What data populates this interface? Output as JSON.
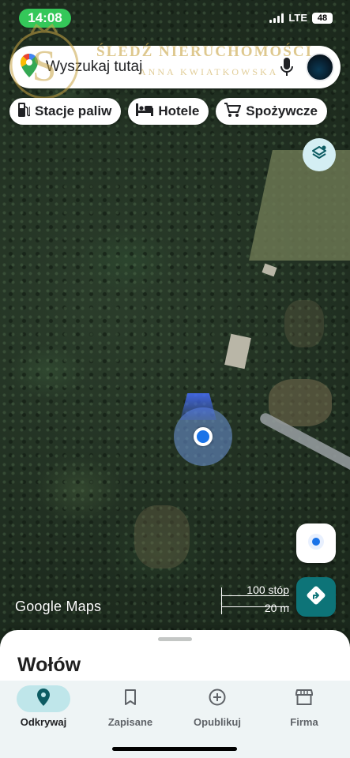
{
  "status_bar": {
    "time": "14:08",
    "network": "LTE",
    "battery": "48"
  },
  "search": {
    "placeholder": "Wyszukaj tutaj"
  },
  "chips": [
    {
      "label": "Stacje paliw",
      "icon": "gas-station-icon"
    },
    {
      "label": "Hotele",
      "icon": "bed-icon"
    },
    {
      "label": "Spożywcze",
      "icon": "cart-icon"
    }
  ],
  "watermark": {
    "title": "ŚLEDŹ NIERUCHOMOŚCI",
    "subtitle": "ANNA KWIATKOWSKA",
    "monogram": "S"
  },
  "map": {
    "attribution": "Google Maps",
    "scale_ft": "100 stóp",
    "scale_m": "20 m"
  },
  "sheet": {
    "title": "Wołów"
  },
  "tabs": [
    {
      "label": "Odkrywaj",
      "icon": "explore-pin-icon",
      "active": true
    },
    {
      "label": "Zapisane",
      "icon": "bookmark-icon",
      "active": false
    },
    {
      "label": "Opublikuj",
      "icon": "add-circle-icon",
      "active": false
    },
    {
      "label": "Firma",
      "icon": "storefront-icon",
      "active": false
    }
  ],
  "colors": {
    "accent": "#0d7478",
    "location": "#1a73e8",
    "status_green": "#34c759",
    "tab_active": "#bfe6ea"
  }
}
